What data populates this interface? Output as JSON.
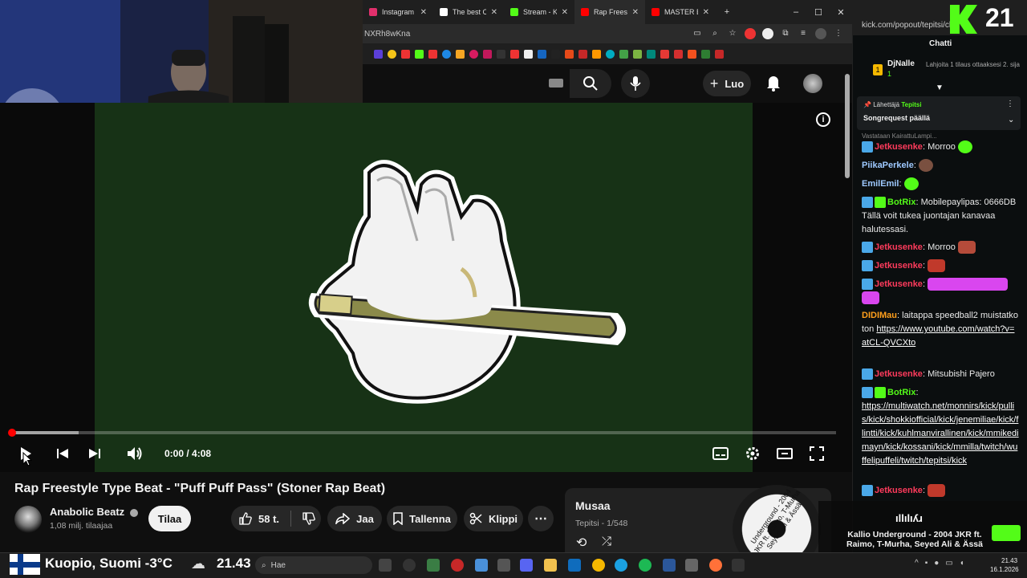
{
  "browser": {
    "tabs": [
      {
        "label": "Instagram",
        "color": "#e1306c"
      },
      {
        "label": "The best Cl",
        "color": "#ffffff"
      },
      {
        "label": "Stream - Ki",
        "color": "#53fc18"
      },
      {
        "label": "Rap Freesty",
        "color": "#ff0000"
      },
      {
        "label": "MASTER BO",
        "color": "#ff0000"
      }
    ],
    "url_fragment": "NXRh8wKna",
    "new_tab": "+",
    "win_min": "–",
    "win_max": "☐",
    "win_close": "✕"
  },
  "youtube": {
    "create_label": "Luo",
    "video": {
      "title": "Rap Freestyle Type Beat - \"Puff Puff Pass\" (Stoner Rap Beat)",
      "time": "0:00 / 4:08",
      "progress": 0.0
    },
    "channel": {
      "name": "Anabolic Beatz",
      "subscribers": "1,08 milj. tilaajaa",
      "subscribe_label": "Tilaa"
    },
    "actions": {
      "likes": "58 t.",
      "share": "Jaa",
      "save": "Tallenna",
      "clip": "Klippi"
    },
    "playlist": {
      "title": "Musaa",
      "subtitle": "Tepitsi - 1/548"
    }
  },
  "kick": {
    "url": "kick.com/popout/tepitsi/ch...",
    "chat_title": "Chatti",
    "viewer_count": "21",
    "top_supporter": {
      "name": "DjNalle",
      "rank": "1",
      "sub": "1",
      "hint": "Lahjoita 1 tilaus ottaaksesi 2. sija"
    },
    "pinned": {
      "sender_label": "Lähettäjä",
      "sender": "Tepitsi",
      "text": "Songrequest päällä"
    },
    "reply_hint": "Vastataan KairattuLampi...",
    "messages": [
      {
        "user": "Jetkusenke",
        "color": "#ff3b5c",
        "text": "Morroo"
      },
      {
        "user": "PiikaPerkele",
        "color": "#9ec9ff",
        "text": ""
      },
      {
        "user": "EmilEmil",
        "color": "#9ec9ff",
        "text": ""
      },
      {
        "user": "BotRix",
        "color": "#53fc18",
        "text": "Mobilepaylipas: 0666DB Tällä voit tukea juontajan kanavaa halutessasi."
      },
      {
        "user": "Jetkusenke",
        "color": "#ff3b5c",
        "text": "Morroo"
      },
      {
        "user": "Jetkusenke",
        "color": "#ff3b5c",
        "text": ""
      },
      {
        "user": "Jetkusenke",
        "color": "#ff3b5c",
        "text": ""
      },
      {
        "user": "DIDIMau",
        "color": "#ff9f1c",
        "text": "laitappa speedball2 muistatko ton",
        "link": "https://www.youtube.com/watch?v=atCL-QVCXto"
      },
      {
        "user": "Jetkusenke",
        "color": "#ff3b5c",
        "text": "Mitsubishi Pajero"
      },
      {
        "user": "BotRix",
        "color": "#53fc18",
        "text": "",
        "link": "https://multiwatch.net/monnirs/kick/pullis/kick/shokkiofficial/kick/jenemiliae/kick/flintti/kick/kuhlmanvirallinen/kick/mmikedimayn/kick/kossani/kick/mmilla/twitch/wuffelipuffeli/twitch/tepitsi/kick"
      },
      {
        "user": "Jetkusenke",
        "color": "#ff3b5c",
        "text": ""
      }
    ]
  },
  "overlay": {
    "song": "Kallio Underground - 2004 JKR ft. Raimo, T-Murha, Seyed Ali & Ässä",
    "record_text": "Underground - 2004 JKR ft. Raimo, T-Murha, Seyed Ali & Ässä",
    "logo": "ıllılıʎɹ",
    "weather": "Kuopio, Suomi -3°C",
    "clock_big": "21.43"
  },
  "taskbar": {
    "search_placeholder": "Hae",
    "time": "21.43",
    "date": "16.1.2026"
  }
}
